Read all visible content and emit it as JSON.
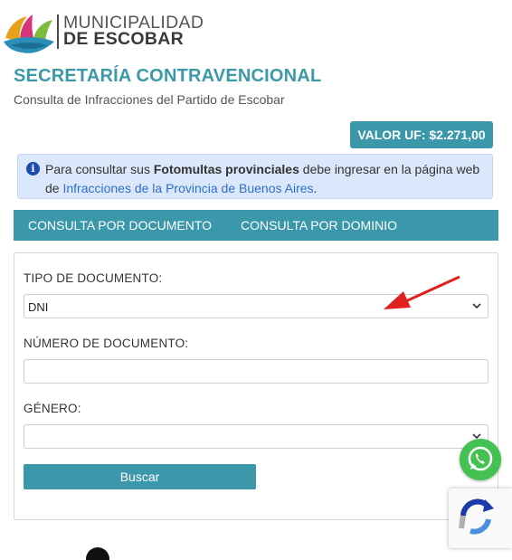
{
  "header": {
    "logo_line1": "MUNICIPALIDAD",
    "logo_line2": "DE ESCOBAR"
  },
  "page": {
    "title": "SECRETARÍA CONTRAVENCIONAL",
    "subtitle": "Consulta de Infracciones del Partido de Escobar"
  },
  "uf_badge": "VALOR UF: $2.271,00",
  "alert": {
    "text1": "Para consultar sus ",
    "bold": "Fotomultas provinciales",
    "text2": " debe ingresar en la página web de ",
    "link": "Infracciones de la Provincia de Buenos Aires",
    "text3": "."
  },
  "tabs": [
    "CONSULTA POR DOCUMENTO",
    "CONSULTA POR DOMINIO"
  ],
  "form": {
    "doc_type_label": "TIPO DE DOCUMENTO:",
    "doc_type_value": "DNI",
    "doc_number_label": "NÚMERO DE DOCUMENTO:",
    "doc_number_value": "",
    "gender_label": "GÉNERO:",
    "gender_value": "",
    "search_button": "Buscar"
  },
  "icons": {
    "info": "info-icon",
    "whatsapp": "whatsapp-icon",
    "recaptcha": "recaptcha-icon",
    "arrow": "red-arrow-annotation"
  },
  "colors": {
    "accent": "#3a98aa",
    "alert_bg": "#dbe8fb",
    "link": "#2e6fc7",
    "annotation": "#e02020"
  }
}
